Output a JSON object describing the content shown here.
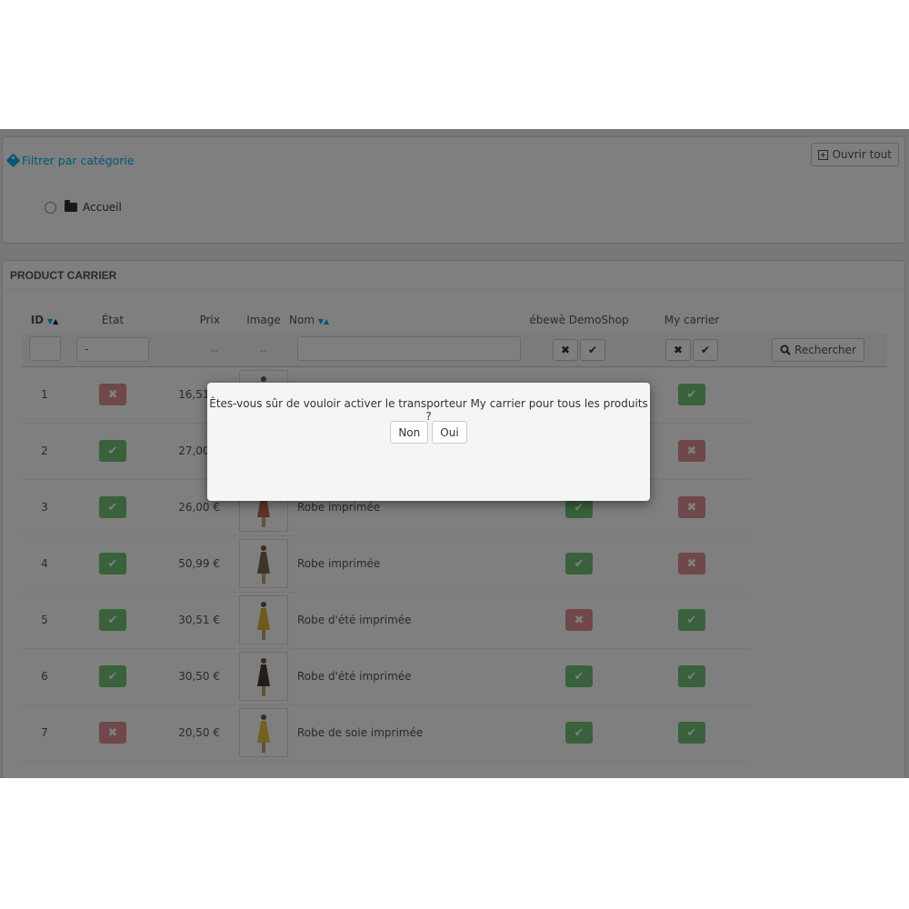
{
  "category_filter": {
    "title": "Filtrer par catégorie",
    "expand_all_label": "Ouvrir tout",
    "tree_root": "Accueil"
  },
  "product_carrier": {
    "title": "PRODUCT CARRIER",
    "columns": {
      "id": "ID",
      "state": "État",
      "price": "Prix",
      "image": "Image",
      "name": "Nom",
      "carrier1": "ébewè DemoShop",
      "carrier2": "My carrier"
    },
    "filters": {
      "state_value": "-",
      "price_placeholder": "--",
      "image_placeholder": "--",
      "no_label": "✖",
      "yes_label": "✔",
      "search_label": "Rechercher"
    },
    "rows": [
      {
        "id": "1",
        "active": false,
        "price": "16,51 €",
        "name": "",
        "carrier1": true,
        "carrier2": true,
        "dress_color": "#3b3b5a"
      },
      {
        "id": "2",
        "active": true,
        "price": "27,00 €",
        "name": "",
        "carrier1": true,
        "carrier2": false,
        "dress_color": "#2c2c2c"
      },
      {
        "id": "3",
        "active": true,
        "price": "26,00 €",
        "name": "Robe imprimée",
        "carrier1": true,
        "carrier2": false,
        "dress_color": "#c4674a"
      },
      {
        "id": "4",
        "active": true,
        "price": "50,99 €",
        "name": "Robe imprimée",
        "carrier1": true,
        "carrier2": false,
        "dress_color": "#7a6a58"
      },
      {
        "id": "5",
        "active": true,
        "price": "30,51 €",
        "name": "Robe d'été imprimée",
        "carrier1": false,
        "carrier2": true,
        "dress_color": "#e0b33a"
      },
      {
        "id": "6",
        "active": true,
        "price": "30,50 €",
        "name": "Robe d'été imprimée",
        "carrier1": true,
        "carrier2": true,
        "dress_color": "#4a3b36"
      },
      {
        "id": "7",
        "active": false,
        "price": "20,50 €",
        "name": "Robe de soie imprimée",
        "carrier1": true,
        "carrier2": true,
        "dress_color": "#e6c43a"
      }
    ]
  },
  "modal": {
    "message": "Êtes-vous sûr de vouloir activer le transporteur My carrier pour tous les produits ?",
    "no_label": "Non",
    "yes_label": "Oui"
  },
  "colors": {
    "accent": "#00aff0",
    "status_on": "#72c279",
    "status_off": "#e08f95",
    "overlay": "rgba(0,0,0,0.5)"
  }
}
